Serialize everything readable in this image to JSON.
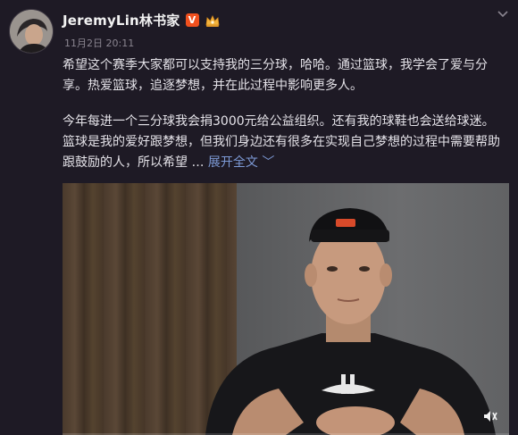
{
  "post": {
    "username": "JeremyLin林书家",
    "vip_badge": "V",
    "timestamp": "11月2日 20:11",
    "text_paragraph_1": "希望这个赛季大家都可以支持我的三分球，哈哈。通过篮球，我学会了爱与分享。热爱篮球，追逐梦想，并在此过程中影响更多人。",
    "text_paragraph_2": "今年每进一个三分球我会捐3000元给公益组织。还有我的球鞋也会送给球迷。篮球是我的爱好跟梦想，但我们身边还有很多在实现自己梦想的过程中需要帮助跟鼓励的人，所以希望",
    "ellipsis": " … ",
    "expand_label": "展开全文",
    "expand_chevron": "﹀"
  },
  "icons": {
    "more": "chevron-down-icon",
    "mute": "mute-icon",
    "member": "member-crown-icon"
  },
  "colors": {
    "background": "#1e1a25",
    "link": "#7d9ad6",
    "vip": "#f0501e",
    "member": "#f2b33d"
  }
}
